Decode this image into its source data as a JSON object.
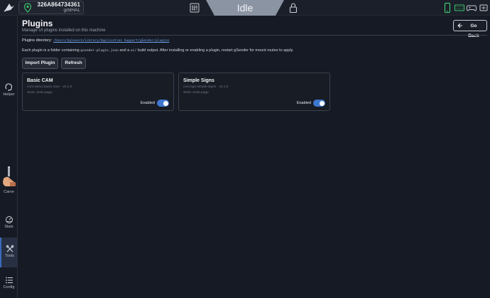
{
  "header": {
    "machine_id": "326A864734361",
    "firmware": "grblHAL",
    "status": "Idle",
    "colors": {
      "status_bg": "#8b94a3",
      "connected": "#3ec36e"
    }
  },
  "sidebar": {
    "items": [
      {
        "label": "Helper",
        "icon": "helper-icon"
      },
      {
        "label": "Carve",
        "icon": "carve-icon"
      },
      {
        "label": "Stats",
        "icon": "stats-icon"
      },
      {
        "label": "Tools",
        "icon": "tools-icon",
        "active": true
      },
      {
        "label": "Config",
        "icon": "config-icon"
      }
    ]
  },
  "page": {
    "title": "Plugins",
    "subtitle": "Manage UI plugins installed on this machine",
    "back_label": "Go Back",
    "directory_label": "Plugins directory:",
    "directory_path": "/Users/kglovern/Library/Application Support/gSender/plugins",
    "info_1": "Each plugin is a folder containing ",
    "info_file": "gsender-plugin.json",
    "info_2": " and a ",
    "info_dir": "ui/",
    "info_3": " build output. After installing or enabling a plugin, restart gSender for mount routes to apply.",
    "import_label": "Import Plugin",
    "refresh_label": "Refresh"
  },
  "plugins": [
    {
      "name": "Basic CAM",
      "id_version": "com.sienci.basic-cam · v0.1.0",
      "slots": "Slots: tools-page",
      "state": "Enabled",
      "enabled": true
    },
    {
      "name": "Simple Signs",
      "id_version": "com.kgn.simple-signs · v0.1.0",
      "slots": "Slots: tools-page",
      "state": "Enabled",
      "enabled": true
    }
  ]
}
